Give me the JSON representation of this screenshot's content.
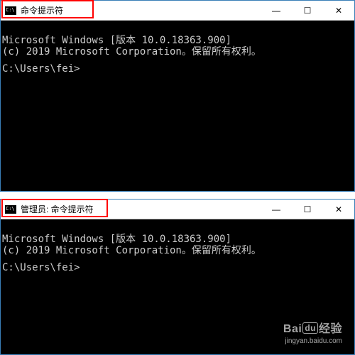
{
  "window1": {
    "title": "命令提示符",
    "line1": "Microsoft Windows [版本 10.0.18363.900]",
    "line2": "(c) 2019 Microsoft Corporation。保留所有权利。",
    "prompt": "C:\\Users\\fei>",
    "controls": {
      "min": "—",
      "max": "☐",
      "close": "✕"
    }
  },
  "window2": {
    "title": "管理员: 命令提示符",
    "line1": "Microsoft Windows [版本 10.0.18363.900]",
    "line2": "(c) 2019 Microsoft Corporation。保留所有权利。",
    "prompt": "C:\\Users\\fei>",
    "controls": {
      "min": "—",
      "max": "☐",
      "close": "✕"
    }
  },
  "watermark": {
    "brand_left": "Bai",
    "brand_mid": "du",
    "brand_right": "经验",
    "url": "jingyan.baidu.com"
  }
}
